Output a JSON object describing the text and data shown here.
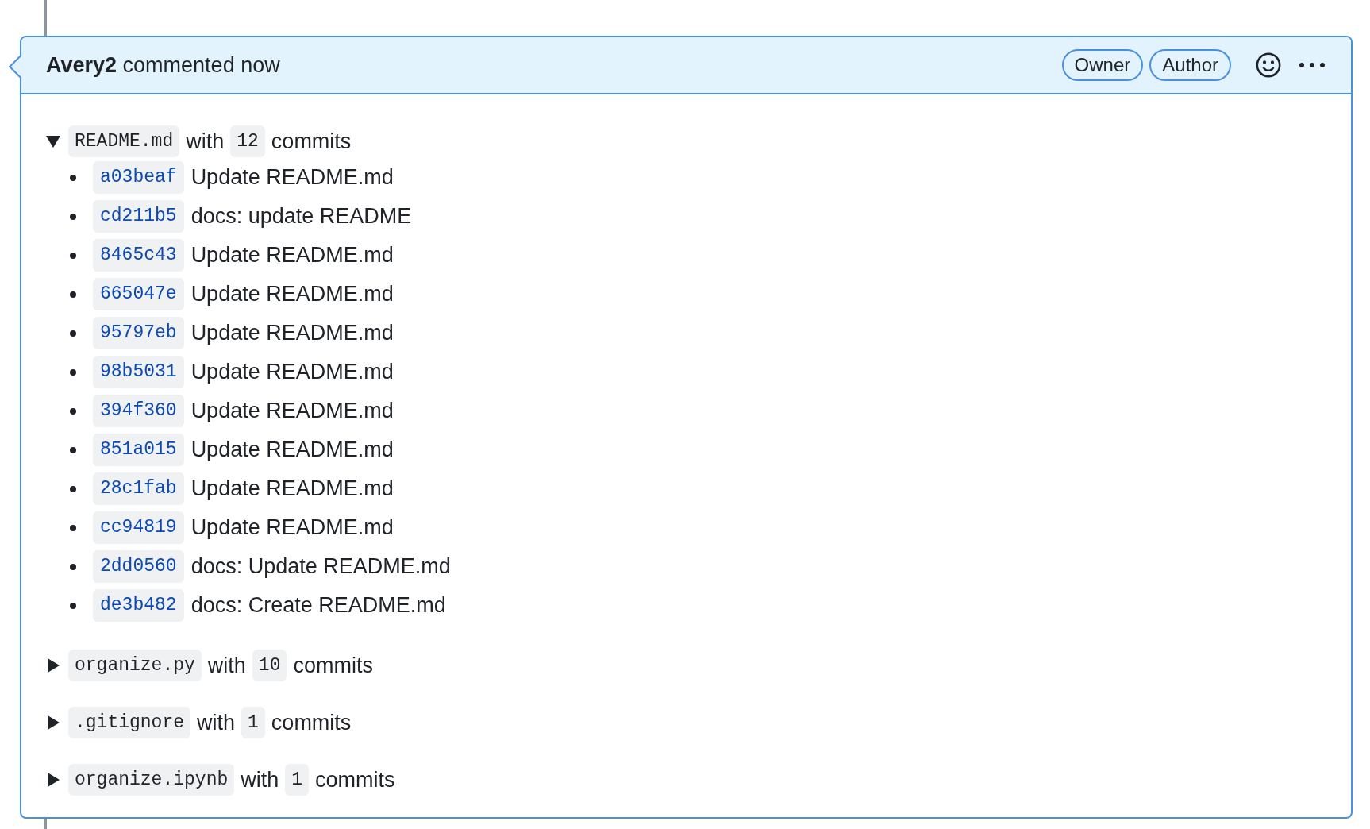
{
  "comment": {
    "header": "**Avery2** commented now",
    "badges": [
      "Owner",
      "Author"
    ]
  },
  "files": [
    {
      "name": "README.md",
      "with": "with",
      "count": "12",
      "commits_label": "commits",
      "expanded": true,
      "commits": [
        {
          "sha": "a03beaf",
          "message": "Update README.md"
        },
        {
          "sha": "cd211b5",
          "message": "docs: update README"
        },
        {
          "sha": "8465c43",
          "message": "Update README.md"
        },
        {
          "sha": "665047e",
          "message": "Update README.md"
        },
        {
          "sha": "95797eb",
          "message": "Update README.md"
        },
        {
          "sha": "98b5031",
          "message": "Update README.md"
        },
        {
          "sha": "394f360",
          "message": "Update README.md"
        },
        {
          "sha": "851a015",
          "message": "Update README.md"
        },
        {
          "sha": "28c1fab",
          "message": "Update README.md"
        },
        {
          "sha": "cc94819",
          "message": "Update README.md"
        },
        {
          "sha": "2dd0560",
          "message": "docs: Update README.md"
        },
        {
          "sha": "de3b482",
          "message": "docs: Create README.md"
        }
      ]
    },
    {
      "name": "organize.py",
      "with": "with",
      "count": "10",
      "commits_label": "commits",
      "expanded": false
    },
    {
      "name": ".gitignore",
      "with": "with",
      "count": "1",
      "commits_label": "commits",
      "expanded": false
    },
    {
      "name": "organize.ipynb",
      "with": "with",
      "count": "1",
      "commits_label": "commits",
      "expanded": false
    }
  ]
}
